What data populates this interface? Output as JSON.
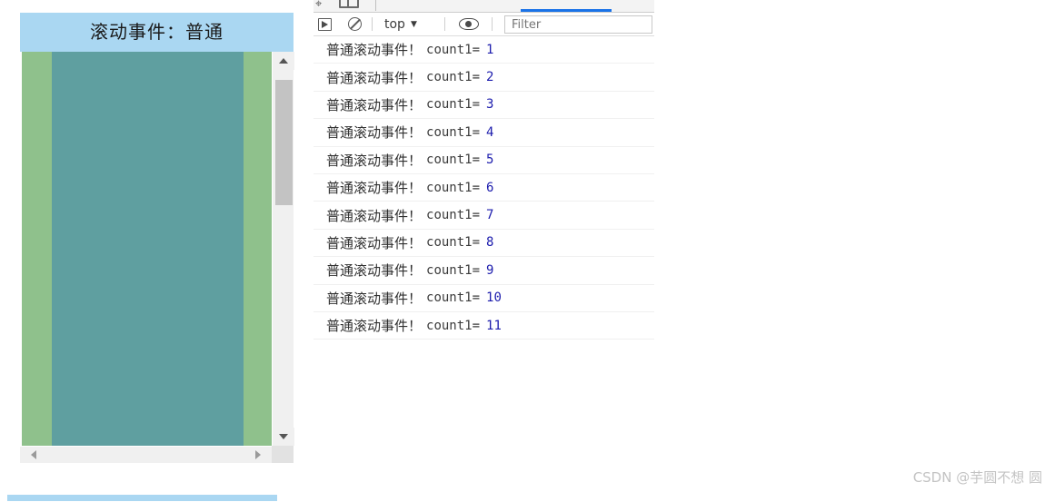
{
  "demo": {
    "title": "滚动事件：普通",
    "scrollbars": {
      "vertical_up_icon": "triangle-up-icon",
      "vertical_down_icon": "triangle-down-icon",
      "horizontal_left_icon": "triangle-left-icon",
      "horizontal_right_icon": "triangle-right-icon"
    },
    "colors": {
      "title_bg": "#aad7f2",
      "outer_block": "#8fc18c",
      "inner_block": "#5f9fa0",
      "scrollbar_track": "#f0f0f0",
      "scrollbar_thumb": "#c3c3c3"
    }
  },
  "devtools": {
    "toolbar": {
      "sidebar_toggle_icon": "sidebar-toggle-icon",
      "clear_console_icon": "clear-console-icon",
      "context_selector": "top",
      "context_caret": "▼",
      "eye_icon": "eye-icon",
      "filter_placeholder": "Filter",
      "filter_value": ""
    },
    "active_tab_accent": "#1a73e8",
    "console_rows": [
      {
        "message": "普通滚动事件！",
        "variable": "count1=",
        "value": "1"
      },
      {
        "message": "普通滚动事件！",
        "variable": "count1=",
        "value": "2"
      },
      {
        "message": "普通滚动事件！",
        "variable": "count1=",
        "value": "3"
      },
      {
        "message": "普通滚动事件！",
        "variable": "count1=",
        "value": "4"
      },
      {
        "message": "普通滚动事件！",
        "variable": "count1=",
        "value": "5"
      },
      {
        "message": "普通滚动事件！",
        "variable": "count1=",
        "value": "6"
      },
      {
        "message": "普通滚动事件！",
        "variable": "count1=",
        "value": "7"
      },
      {
        "message": "普通滚动事件！",
        "variable": "count1=",
        "value": "8"
      },
      {
        "message": "普通滚动事件！",
        "variable": "count1=",
        "value": "9"
      },
      {
        "message": "普通滚动事件！",
        "variable": "count1=",
        "value": "10"
      },
      {
        "message": "普通滚动事件！",
        "variable": "count1=",
        "value": "11"
      }
    ]
  },
  "watermark": {
    "text": "CSDN @芋圆不想 圆"
  }
}
